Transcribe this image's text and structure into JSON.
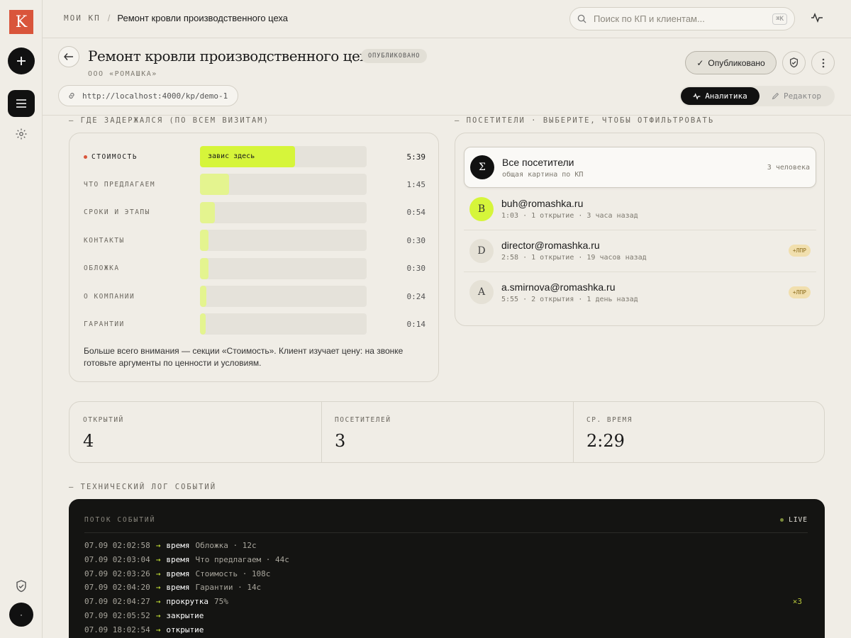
{
  "app": {
    "logo_letter": "K"
  },
  "breadcrumb": {
    "root": "МОИ КП",
    "separator": "/",
    "current": "Ремонт кровли производственного цеха"
  },
  "search": {
    "placeholder": "Поиск по КП и клиентам...",
    "shortcut": "⌘K"
  },
  "header": {
    "title": "Ремонт кровли производственного цеха",
    "status_badge": "ОПУБЛИКОВАНО",
    "company": "ООО «РОМАШКА»",
    "url": "http://localhost:4000/kp/demo-1",
    "published_button": "Опубликовано",
    "tabs": [
      {
        "label": "Аналитика",
        "active": true
      },
      {
        "label": "Редактор",
        "active": false
      }
    ]
  },
  "dwell": {
    "section_title": "— ГДЕ ЗАДЕРЖАЛСЯ (ПО ВСЕМ ВИЗИТАМ)",
    "highlight_text": "завис здесь",
    "rows": [
      {
        "label": "СТОИМОСТЬ",
        "time": "5:39",
        "seconds": 339
      },
      {
        "label": "ЧТО ПРЕДЛАГАЕМ",
        "time": "1:45",
        "seconds": 105
      },
      {
        "label": "СРОКИ И ЭТАПЫ",
        "time": "0:54",
        "seconds": 54
      },
      {
        "label": "КОНТАКТЫ",
        "time": "0:30",
        "seconds": 30
      },
      {
        "label": "ОБЛОЖКА",
        "time": "0:30",
        "seconds": 30
      },
      {
        "label": "О КОМПАНИИ",
        "time": "0:24",
        "seconds": 24
      },
      {
        "label": "ГАРАНТИИ",
        "time": "0:14",
        "seconds": 14
      }
    ],
    "note": "Больше всего внимания — секции «Стоимость». Клиент изучает цену: на звонке готовьте аргументы по ценности и условиям.",
    "colors": {
      "accent": "#d6f53a",
      "fill": "#e4f48f",
      "track": "#e5e2da"
    }
  },
  "visitors": {
    "section_title": "— ПОСЕТИТЕЛИ · ВЫБЕРИТЕ, ЧТОБЫ ОТФИЛЬТРОВАТЬ",
    "items": [
      {
        "avatar": "Σ",
        "name": "Все посетители",
        "sub": "общая картина по КП",
        "right": "3 человека",
        "selected": true
      },
      {
        "avatar": "B",
        "name": "buh@romashka.ru",
        "sub": "1:03 · 1 открытие · 3 часа назад",
        "right": "",
        "selected": false
      },
      {
        "avatar": "D",
        "name": "director@romashka.ru",
        "sub": "2:58 · 1 открытие · 19 часов назад",
        "right": "+ЛПР",
        "selected": false
      },
      {
        "avatar": "A",
        "name": "a.smirnova@romashka.ru",
        "sub": "5:55 · 2 открытия · 1 день назад",
        "right": "+ЛПР",
        "selected": false
      }
    ]
  },
  "stats": [
    {
      "label": "ОТКРЫТИЙ",
      "value": "4"
    },
    {
      "label": "ПОСЕТИТЕЛЕЙ",
      "value": "3"
    },
    {
      "label": "СР. ВРЕМЯ",
      "value": "2:29"
    }
  ],
  "log": {
    "section_title": "— ТЕХНИЧЕСКИЙ ЛОГ СОБЫТИЙ",
    "stream_title": "ПОТОК СОБЫТИЙ",
    "live_label": "LIVE",
    "lines": [
      {
        "ts": "07.09 02:02:58",
        "arrow": "→",
        "event": "время",
        "detail": "Обложка · 12с",
        "badge": ""
      },
      {
        "ts": "07.09 02:03:04",
        "arrow": "→",
        "event": "время",
        "detail": "Что предлагаем · 44с",
        "badge": ""
      },
      {
        "ts": "07.09 02:03:26",
        "arrow": "→",
        "event": "время",
        "detail": "Стоимость · 108с",
        "badge": ""
      },
      {
        "ts": "07.09 02:04:20",
        "arrow": "→",
        "event": "время",
        "detail": "Гарантии · 14с",
        "badge": ""
      },
      {
        "ts": "07.09 02:04:27",
        "arrow": "→",
        "event": "прокрутка",
        "detail": "75%",
        "badge": "×3"
      },
      {
        "ts": "07.09 02:05:52",
        "arrow": "→",
        "event": "закрытие",
        "detail": "",
        "badge": ""
      },
      {
        "ts": "07.09 18:02:54",
        "arrow": "→",
        "event": "открытие",
        "detail": "",
        "badge": ""
      }
    ]
  },
  "sidebar": {
    "avatar_glyph": "·"
  }
}
